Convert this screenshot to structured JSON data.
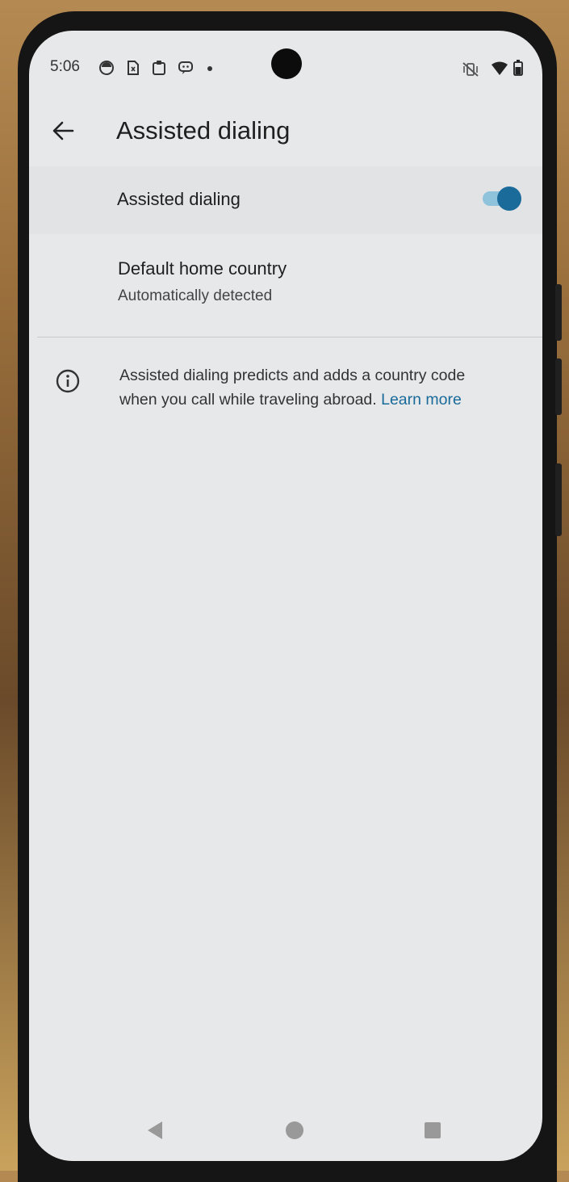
{
  "status_bar": {
    "time": "5:06",
    "left_icons": [
      "notification-icon",
      "sim-icon",
      "clipboard-icon",
      "message-icon",
      "dot-icon"
    ],
    "right_icons": [
      "vibrate-off-icon",
      "wifi-icon",
      "battery-icon"
    ]
  },
  "app_bar": {
    "title": "Assisted dialing"
  },
  "toggle_row": {
    "label": "Assisted dialing",
    "enabled": true,
    "accent_color": "#1a6a9a"
  },
  "country_row": {
    "title": "Default home country",
    "subtitle": "Automatically detected"
  },
  "info": {
    "text": "Assisted dialing predicts and adds a country code when you call while traveling abroad.",
    "link": "Learn more"
  },
  "nav_bar": {
    "buttons": [
      "back",
      "home",
      "recents"
    ]
  }
}
